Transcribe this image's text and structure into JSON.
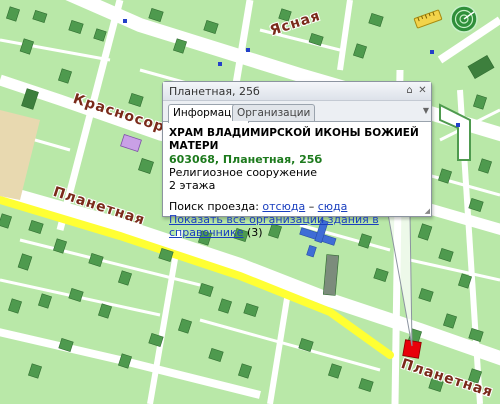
{
  "map": {
    "street_labels": {
      "yasnaya": "Ясная",
      "krasno": "Красносор",
      "planetnaya_top": "Планетная",
      "planetnaya_bottom": "Планетная"
    },
    "colors": {
      "ground": "#b9e8a8",
      "road": "#ffffff",
      "block": "#9fd88e",
      "building": "#4e9a4e",
      "highlight_road": "#ffff33",
      "target_building": "#e8000a",
      "church_building": "#c9a0e6",
      "blue_building": "#3f6dd6"
    },
    "toolbar": {
      "ruler_icon": "ruler-icon",
      "radar_icon": "radar-icon"
    }
  },
  "popup": {
    "title": "Планетная, 25б",
    "pin_glyph": "⌂",
    "close_glyph": "✕",
    "tabs": [
      "Информация",
      "Организации"
    ],
    "name": "ХРАМ ВЛАДИМИРСКОЙ ИКОНЫ БОЖИЕЙ МАТЕРИ",
    "address": "603068, Планетная, 25б",
    "type": "Религиозное сооружение",
    "floors": "2 этажа",
    "route_label": "Поиск проезда:",
    "route_from": "отсюда",
    "route_sep": "–",
    "route_to": "сюда",
    "all_orgs_link": "Показать все организации здания в справочнике",
    "all_orgs_count": "(3)"
  }
}
